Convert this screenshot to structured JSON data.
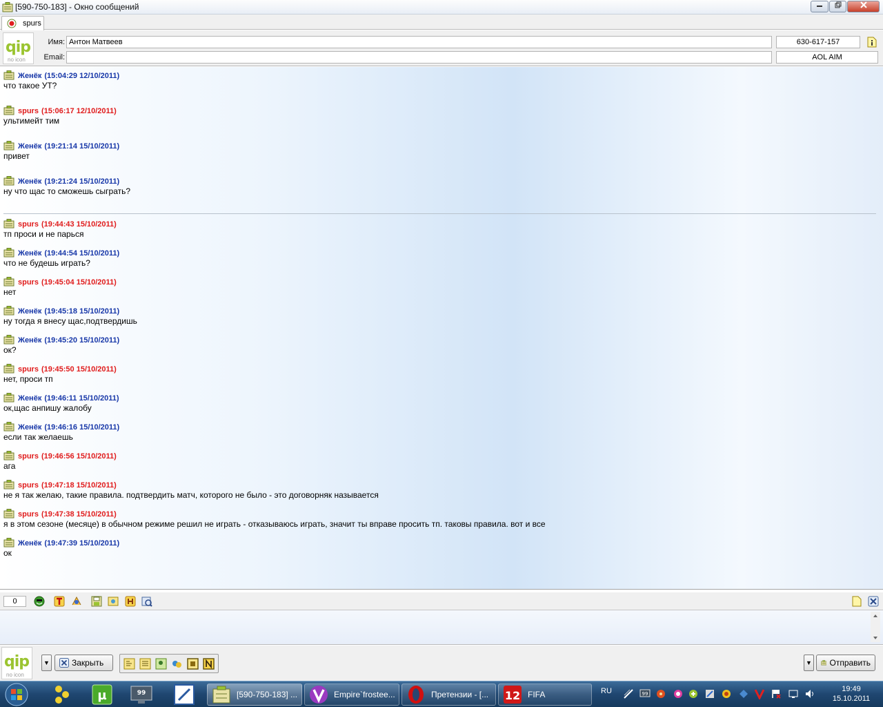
{
  "window": {
    "title": "[590-750-183] - Окно сообщений",
    "controls": [
      "minimize",
      "maximize",
      "close"
    ]
  },
  "tab": {
    "label": "spurs",
    "icon": "contact-status-icon"
  },
  "contact": {
    "name_label": "Имя:",
    "name_value": "Антон  Матвеев",
    "email_label": "Email:",
    "email_value": "",
    "uin": "630-617-157",
    "protocol": "AOL AIM"
  },
  "messages": [
    {
      "author": "Женёк",
      "time": "(15:04:29 12/10/2011)",
      "text": "что такое УТ?",
      "dir": "in"
    },
    {
      "author": "spurs",
      "time": "(15:06:17 12/10/2011)",
      "text": "ультимейт тим",
      "dir": "out"
    },
    {
      "author": "Женёк",
      "time": "(19:21:14 15/10/2011)",
      "text": "привет",
      "dir": "in"
    },
    {
      "author": "Женёк",
      "time": "(19:21:24 15/10/2011)",
      "text": "ну что щас то сможешь сыграть?",
      "dir": "in"
    },
    {
      "author": "spurs",
      "time": "(19:44:43 15/10/2011)",
      "text": "тп проси и не парься",
      "dir": "out"
    },
    {
      "author": "Женёк",
      "time": "(19:44:54 15/10/2011)",
      "text": "что не будешь играть?",
      "dir": "in"
    },
    {
      "author": "spurs",
      "time": "(19:45:04 15/10/2011)",
      "text": "нет",
      "dir": "out"
    },
    {
      "author": "Женёк",
      "time": "(19:45:18 15/10/2011)",
      "text": "ну тогда я внесу щас,подтвердишь",
      "dir": "in"
    },
    {
      "author": "Женёк",
      "time": "(19:45:20 15/10/2011)",
      "text": "ок?",
      "dir": "in"
    },
    {
      "author": "spurs",
      "time": "(19:45:50 15/10/2011)",
      "text": "нет, проси тп",
      "dir": "out"
    },
    {
      "author": "Женёк",
      "time": "(19:46:11 15/10/2011)",
      "text": "ок,щас анпишу жалобу",
      "dir": "in"
    },
    {
      "author": "Женёк",
      "time": "(19:46:16 15/10/2011)",
      "text": "если так желаешь",
      "dir": "in"
    },
    {
      "author": "spurs",
      "time": "(19:46:56 15/10/2011)",
      "text": "ага",
      "dir": "out"
    },
    {
      "author": "spurs",
      "time": "(19:47:18 15/10/2011)",
      "text": "не я так желаю, такие правила. подтвердить матч, которого не было - это договорняк называется",
      "dir": "out"
    },
    {
      "author": "spurs",
      "time": "(19:47:38 15/10/2011)",
      "text": "я в этом сезоне (месяце) в обычном режиме решил не играть - отказываюсь играть, значит ты вправе просить тп. таковы правила. вот и все",
      "dir": "out"
    },
    {
      "author": "Женёк",
      "time": "(19:47:39 15/10/2011)",
      "text": "ок",
      "dir": "in"
    }
  ],
  "input": {
    "char_count": "0",
    "text": ""
  },
  "buttons": {
    "close": "Закрыть",
    "send": "Отправить"
  },
  "taskbar": {
    "tasks": [
      {
        "label": "[590-750-183] ...",
        "icon": "qip-icon",
        "active": true
      },
      {
        "label": "Empire`frostee...",
        "icon": "v-app-icon",
        "active": false
      },
      {
        "label": "Претензии - [...",
        "icon": "opera-icon",
        "active": false
      },
      {
        "label": "FIFA",
        "icon": "app-12-icon",
        "active": false
      }
    ],
    "pinned": [
      "utorrent-icon",
      "monitor-99-icon",
      "phone-app-icon"
    ],
    "pinned_numbers": {
      "monitor": "99",
      "app": "12"
    },
    "language": "RU",
    "clock_time": "19:49",
    "clock_date": "15.10.2011",
    "tray_badge": "99"
  },
  "logo": {
    "mark": "qip",
    "sub": "no icon"
  },
  "colors": {
    "incoming_author": "#1737a8",
    "outgoing_author": "#e01b1b",
    "logo_green": "#9bc431"
  }
}
